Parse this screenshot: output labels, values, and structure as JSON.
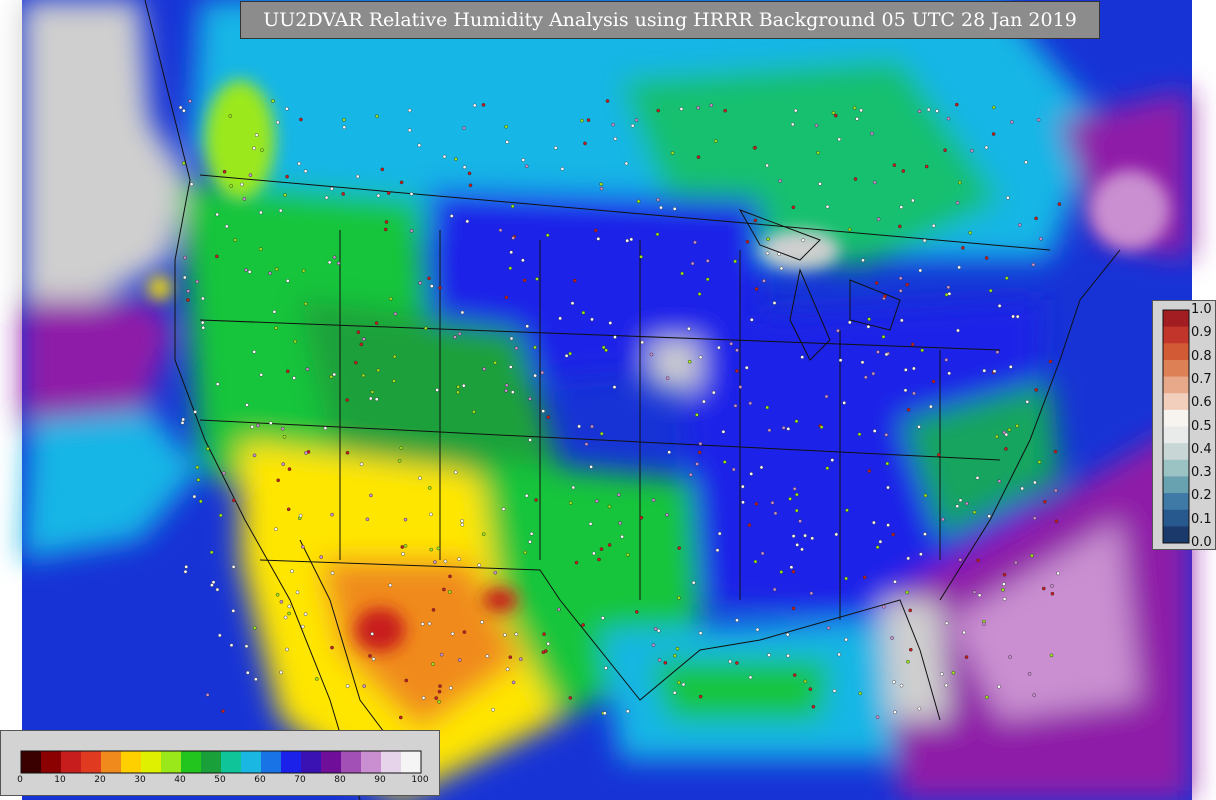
{
  "title": "UU2DVAR Relative Humidity Analysis using HRRR Background 05 UTC 28 Jan 2019",
  "colorbar_right": {
    "labels": [
      "1.0",
      "0.9",
      "0.8",
      "0.7",
      "0.6",
      "0.5",
      "0.4",
      "0.3",
      "0.2",
      "0.1",
      "0.0"
    ],
    "colors": [
      "#1b3a6b",
      "#27598f",
      "#3f7aa6",
      "#68a1b0",
      "#9bc3c3",
      "#c9d6d6",
      "#e9ebeb",
      "#f7f3ef",
      "#f2cfbd",
      "#e7a98a",
      "#dd8055",
      "#d25a35",
      "#c2352a",
      "#a11d22"
    ]
  },
  "colorbar_bottom": {
    "labels": [
      "0",
      "10",
      "20",
      "30",
      "40",
      "50",
      "60",
      "70",
      "80",
      "90",
      "100"
    ],
    "colors": [
      "#3a0000",
      "#8b0000",
      "#c81d1d",
      "#e03a20",
      "#f08a1c",
      "#ffd000",
      "#dff000",
      "#9be81a",
      "#22c51e",
      "#1aa03a",
      "#10c49a",
      "#1ab7e3",
      "#1873e6",
      "#1b21e8",
      "#3a12b4",
      "#6e0e99",
      "#a24fb6",
      "#c98fd0",
      "#e6d4ea",
      "#f5f5f5"
    ]
  },
  "colors": {
    "ocean_deep": "#1733d6",
    "ocean_cyan": "#19b6e6",
    "mid_green": "#12c53b",
    "dry_yellow": "#ffe600",
    "dry_orange": "#f08a1c",
    "very_dry_red": "#c81d1d",
    "saturated_violet": "#8f1ea8",
    "nodata_gray": "#cfcfcf"
  }
}
